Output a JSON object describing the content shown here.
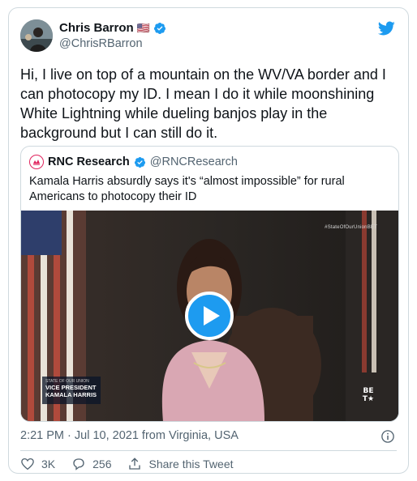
{
  "author": {
    "name": "Chris Barron",
    "flag": "🇺🇸",
    "handle": "@ChrisRBarron",
    "verified": true
  },
  "tweet_text": "Hi, I live on top of a mountain on the WV/VA border and I can photocopy my ID. I mean I do it while moonshining White Lightning while dueling banjos play in the background but I can still do it.",
  "quoted": {
    "name": "RNC Research",
    "handle": "@RNCResearch",
    "verified": true,
    "text": "Kamala Harris absurdly says it's “almost impossible” for rural Americans to photocopy their ID",
    "video": {
      "overlay_hashtag": "#StateOfOurUnionBET",
      "lower_third_small": "STATE OF OUR UNION",
      "lower_third_line1": "VICE PRESIDENT",
      "lower_third_line2": "KAMALA HARRIS",
      "network_logo_top": "BE",
      "network_logo_bottom": "T★"
    }
  },
  "meta": {
    "timestamp": "2:21 PM · Jul 10, 2021 from Virginia, USA"
  },
  "actions": {
    "likes": "3K",
    "replies": "256",
    "share_label": "Share this Tweet"
  },
  "colors": {
    "twitter_blue": "#1d9bf0",
    "text_primary": "#0f1419",
    "text_secondary": "#536471",
    "border": "#cfd9de"
  },
  "icons": [
    "twitter-bird-icon",
    "verified-badge-icon",
    "info-icon",
    "heart-icon",
    "reply-icon",
    "share-icon",
    "play-icon"
  ]
}
